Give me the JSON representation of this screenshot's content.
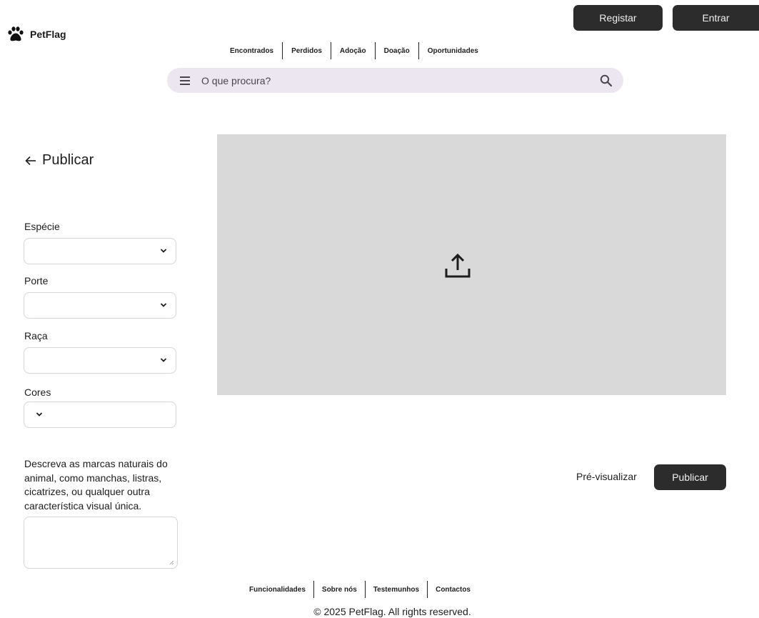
{
  "brand": {
    "name": "PetFlag",
    "icon": "paw-icon"
  },
  "auth": {
    "register_label": "Registar",
    "login_label": "Entrar"
  },
  "top_nav": [
    "Encontrados",
    "Perdidos",
    "Adoção",
    "Doação",
    "Oportunidades"
  ],
  "search": {
    "placeholder": "O que procura?",
    "menu_icon": "menu-icon",
    "search_icon": "search-icon"
  },
  "page": {
    "title": "Publicar",
    "back_icon": "arrow-left-icon"
  },
  "form": {
    "fields": [
      {
        "label": "Espécie",
        "value": ""
      },
      {
        "label": "Porte",
        "value": ""
      },
      {
        "label": "Raça",
        "value": ""
      },
      {
        "label": "Cores",
        "value": ""
      }
    ],
    "description_label": "Descreva as marcas naturais do animal, como manchas, listras, cicatrizes, ou qualquer outra característica visual única.",
    "description_value": ""
  },
  "upload": {
    "icon": "upload-icon"
  },
  "actions": {
    "preview_label": "Pré-visualizar",
    "publish_label": "Publicar"
  },
  "footer": {
    "nav": [
      "Funcionalidades",
      "Sobre nós",
      "Testemunhos",
      "Contactos"
    ],
    "copyright": "© 2025 PetFlag.  All rights reserved."
  }
}
